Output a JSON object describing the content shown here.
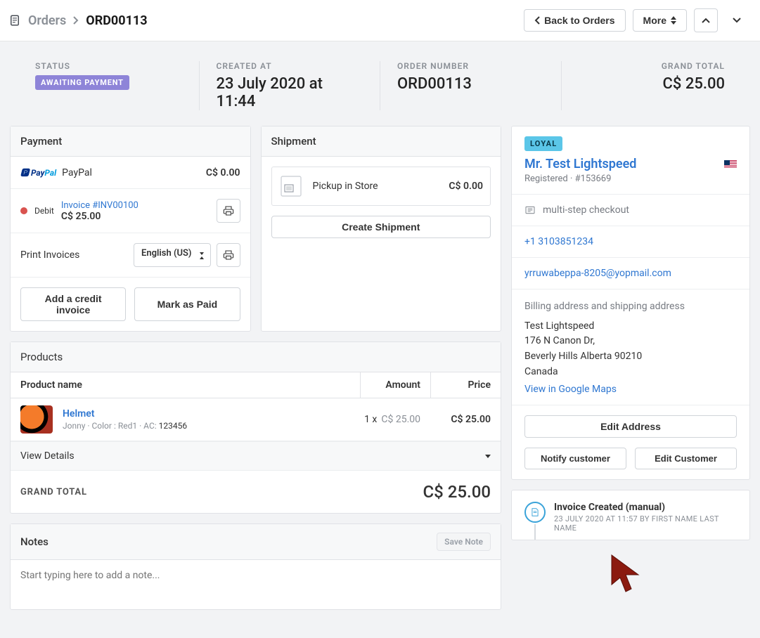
{
  "breadcrumb": {
    "root": "Orders",
    "current": "ORD00113"
  },
  "topbar": {
    "back_label": "Back to Orders",
    "more_label": "More"
  },
  "summary": {
    "status_label": "STATUS",
    "status_badge": "AWAITING PAYMENT",
    "created_label": "CREATED AT",
    "created_value": "23 July 2020 at 11:44",
    "order_no_label": "ORDER NUMBER",
    "order_no_value": "ORD00113",
    "grand_total_label": "GRAND TOTAL",
    "grand_total_value": "C$ 25.00"
  },
  "payment": {
    "title": "Payment",
    "paypal_name": "PayPal",
    "paypal_amount": "C$ 0.00",
    "debit_label": "Debit",
    "invoice_link": "Invoice #INV00100",
    "invoice_amount": "C$ 25.00",
    "print_label": "Print Invoices",
    "lang_selected": "English (US)",
    "add_credit_label": "Add a credit invoice",
    "mark_paid_label": "Mark as Paid"
  },
  "shipment": {
    "title": "Shipment",
    "method": "Pickup in Store",
    "amount": "C$ 0.00",
    "create_label": "Create Shipment"
  },
  "products": {
    "title": "Products",
    "col_name": "Product name",
    "col_amount": "Amount",
    "col_price": "Price",
    "rows": [
      {
        "name": "Helmet",
        "sub_prefix": "Jonny · Color : Red1 · AC: ",
        "ac": "123456",
        "qty": "1 x ",
        "unit_price": "C$ 25.00",
        "line_price": "C$ 25.00"
      }
    ],
    "view_details": "View Details",
    "grand_label": "GRAND TOTAL",
    "grand_value": "C$ 25.00"
  },
  "notes": {
    "title": "Notes",
    "save_label": "Save Note",
    "placeholder": "Start typing here to add a note..."
  },
  "customer": {
    "loyal_badge": "LOYAL",
    "name": "Mr. Test Lightspeed",
    "subline": "Registered · #153669",
    "checkout_type": "multi-step checkout",
    "phone": "+1 3103851234",
    "email": "yrruwabeppa-8205@yopmail.com",
    "address_label": "Billing address and shipping address",
    "address": {
      "name": "Test Lightspeed",
      "line1": "176 N Canon Dr,",
      "line2": "Beverly Hills Alberta 90210",
      "country": "Canada"
    },
    "maps_link": "View in Google Maps",
    "edit_address_label": "Edit Address",
    "notify_label": "Notify customer",
    "edit_customer_label": "Edit Customer"
  },
  "timeline": {
    "event_title": "Invoice Created (manual)",
    "event_sub": "23 JULY 2020 AT 11:57 BY FIRST NAME LAST NAME"
  }
}
